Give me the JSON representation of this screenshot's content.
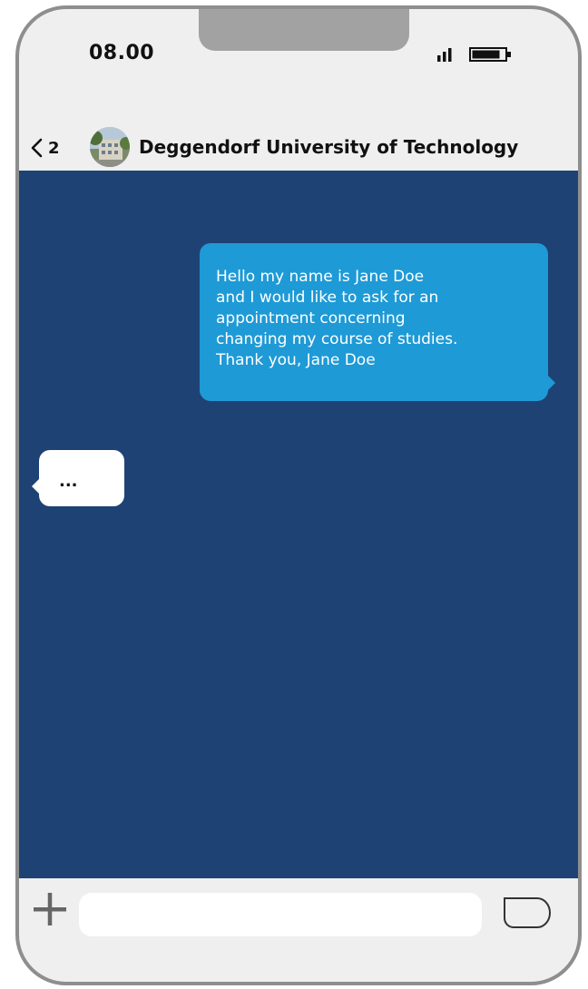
{
  "status_bar": {
    "time": "08.00",
    "signal_icon": "signal-bars-icon",
    "battery_icon": "battery-icon"
  },
  "header": {
    "back_icon": "chevron-left-icon",
    "back_count": "2",
    "avatar_icon": "contact-avatar",
    "contact_name": "Deggendorf University of Technology"
  },
  "messages": {
    "outgoing": {
      "lines": [
        "Hello my name is Jane Doe",
        "and I would like to ask for an",
        "appointment concerning",
        "changing my course of studies.",
        "Thank you, Jane Doe"
      ]
    },
    "incoming": {
      "text": "..."
    }
  },
  "composer": {
    "plus_icon": "plus-icon",
    "input_value": "",
    "send_icon": "send-icon"
  },
  "colors": {
    "chat_background": "#1f4274",
    "outgoing_bubble": "#1e9ad6",
    "incoming_bubble": "#ffffff",
    "frame": "#8e8e8e",
    "notch": "#a2a2a2",
    "bars": "#efefef"
  }
}
